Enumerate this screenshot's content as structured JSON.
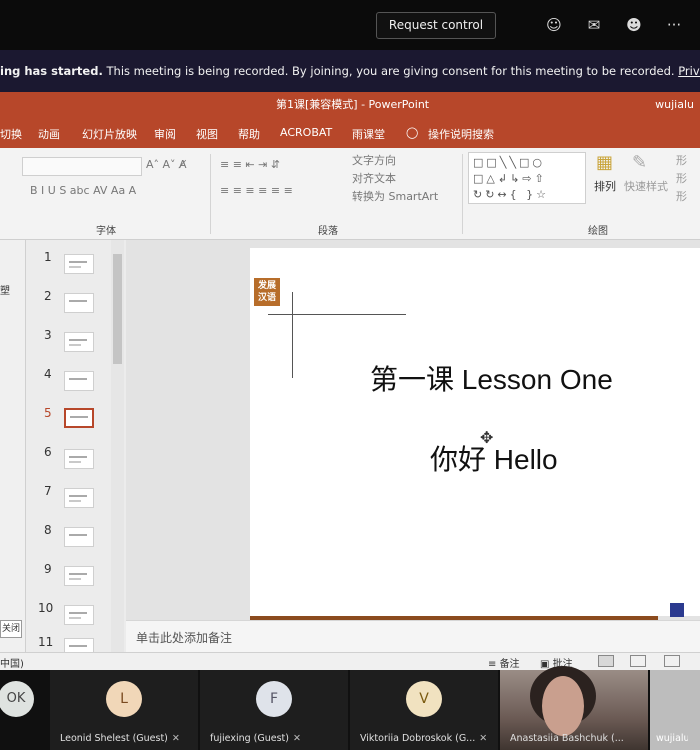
{
  "teams": {
    "request_control": "Request control",
    "icons": [
      "people-icon",
      "chat-icon",
      "reactions-icon",
      "more-icon"
    ],
    "more_glyph": "···",
    "banner": {
      "bold": "ing has started.",
      "text": " This meeting is being recorded. By joining, you are giving consent for this meeting to be recorded.",
      "link": "Privacy policy"
    }
  },
  "ppt": {
    "window_title": "第1课[兼容模式]  -  PowerPoint",
    "user": "wujialu",
    "menu": [
      "切换",
      "动画",
      "幻灯片放映",
      "审阅",
      "视图",
      "帮助",
      "ACROBAT",
      "雨课堂",
      "操作说明搜索"
    ],
    "ribbon": {
      "font_group": "字体",
      "paragraph_group": "段落",
      "drawing_group": "绘图",
      "text_direction": "文字方向",
      "align_text": "对齐文本",
      "smartart": "转换为 SmartArt",
      "arrange": "排列",
      "quick_styles": "快速样式",
      "shape_fill": "形",
      "shape_outline": "形",
      "shape_effects": "形",
      "font_buttons": "B  I  U  S  abc  AV  Aa  A",
      "font_size_buttons": "A˄  A˅  A̸"
    },
    "left_strip_text": "塑",
    "close_label": "关闭",
    "thumbnails": [
      "1",
      "2",
      "3",
      "4",
      "5",
      "6",
      "7",
      "8",
      "9",
      "10",
      "11"
    ],
    "selected_slide": "5",
    "slide": {
      "logo": "发展\n汉语",
      "title": "第一课 Lesson One",
      "subtitle": "你好  Hello"
    },
    "notes_placeholder": "单击此处添加备注",
    "status": {
      "language": "中国)",
      "notes": "备注",
      "comments": "批注"
    }
  },
  "participants": [
    {
      "initial": "OK",
      "name": "",
      "avatar_color": "#dfe3e0"
    },
    {
      "initial": "L",
      "name": "Leonid Shelest (Guest)",
      "avatar_color": "#f1d7b8"
    },
    {
      "initial": "F",
      "name": "fujiexing (Guest)",
      "avatar_color": "#dfe3ea"
    },
    {
      "initial": "V",
      "name": "Viktoriia Dobroskok (G...",
      "avatar_color": "#f1e2c0"
    },
    {
      "initial": "",
      "name": "Anastasiia Bashchuk (...",
      "avatar_color": ""
    },
    {
      "initial": "",
      "name": "wujialu",
      "avatar_color": ""
    }
  ]
}
